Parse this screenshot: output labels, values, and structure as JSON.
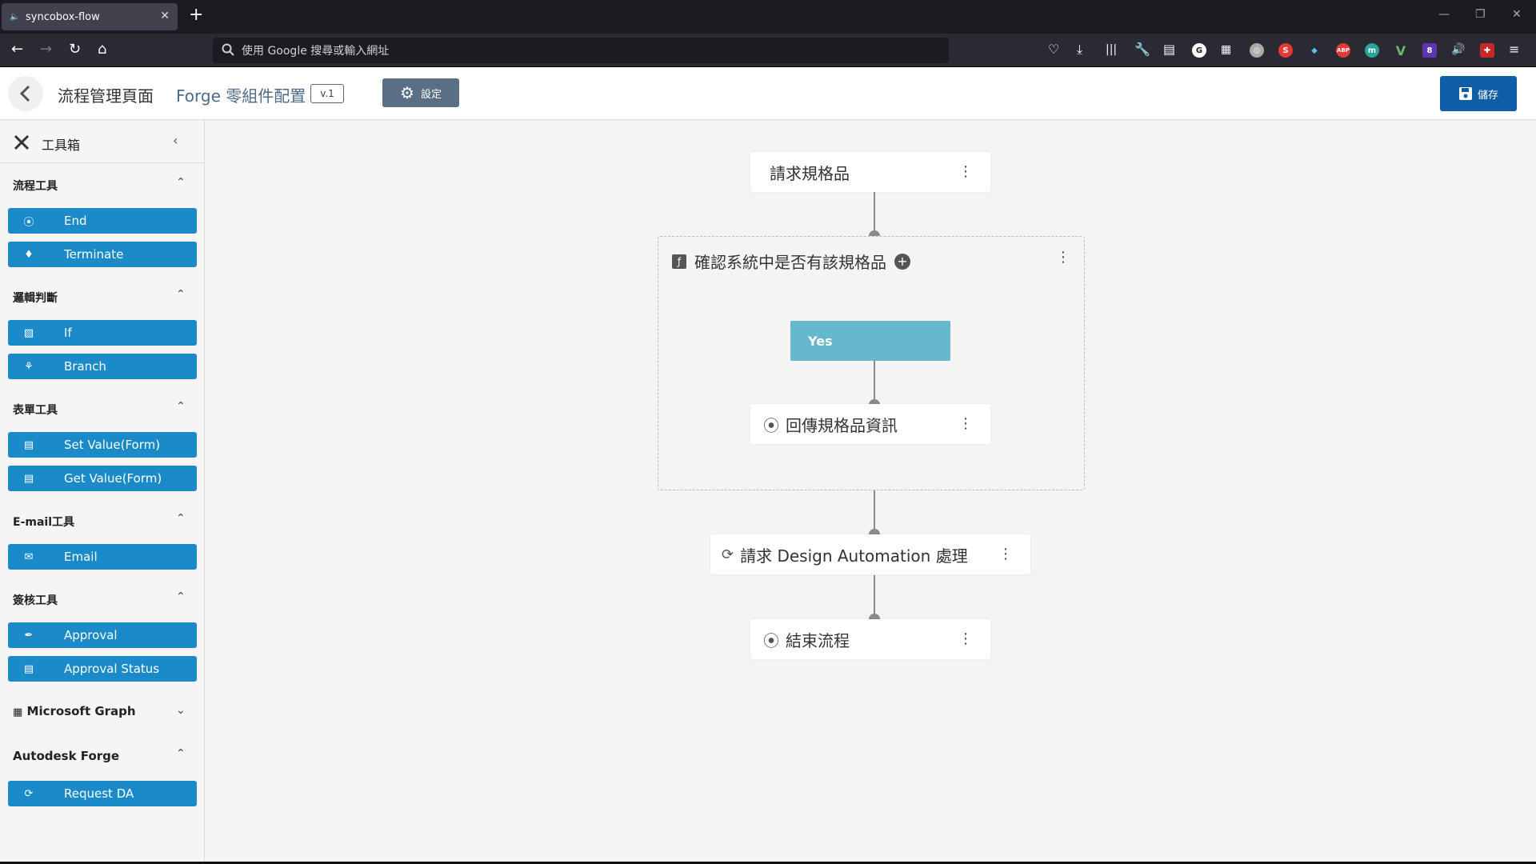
{
  "browser": {
    "tab_title": "syncobox-flow",
    "url_placeholder": "使用 Google 搜尋或輸入網址",
    "extensions": [
      "S",
      "ABP",
      "m",
      "V",
      "8"
    ]
  },
  "header": {
    "page_title": "流程管理頁面",
    "subtitle": "Forge 零組件配置",
    "version": "v.1",
    "settings_label": "設定",
    "save_label": "儲存"
  },
  "sidebar": {
    "title": "工具箱",
    "sections": [
      {
        "title": "流程工具",
        "items": [
          {
            "label": "End",
            "icon": "stop-circle-icon"
          },
          {
            "label": "Terminate",
            "icon": "drop-icon"
          }
        ]
      },
      {
        "title": "邏輯判斷",
        "items": [
          {
            "label": "If",
            "icon": "if-icon"
          },
          {
            "label": "Branch",
            "icon": "branch-icon"
          }
        ]
      },
      {
        "title": "表單工具",
        "items": [
          {
            "label": "Set Value(Form)",
            "icon": "form-edit-icon"
          },
          {
            "label": "Get Value(Form)",
            "icon": "form-search-icon"
          }
        ]
      },
      {
        "title": "E-mail工具",
        "items": [
          {
            "label": "Email",
            "icon": "envelope-icon"
          }
        ]
      },
      {
        "title": "簽核工具",
        "items": [
          {
            "label": "Approval",
            "icon": "feather-icon"
          },
          {
            "label": "Approval Status",
            "icon": "form-status-icon"
          }
        ]
      },
      {
        "title": "Microsoft Graph",
        "items": []
      },
      {
        "title": "Autodesk Forge",
        "items": [
          {
            "label": "Request DA",
            "icon": "rotate-3d-icon"
          }
        ]
      }
    ]
  },
  "flow": {
    "node1": "請求規格品",
    "if_node": "確認系統中是否有該規格品",
    "yes_branch": "Yes",
    "node_return": "回傳規格品資訊",
    "node_da": "請求 Design Automation 處理",
    "node_end": "結束流程"
  },
  "colors": {
    "tool_button": "#1a8ac9",
    "save_button": "#0e5ea6",
    "settings_button": "#5a6f86",
    "yes_branch": "#66b8cc"
  }
}
